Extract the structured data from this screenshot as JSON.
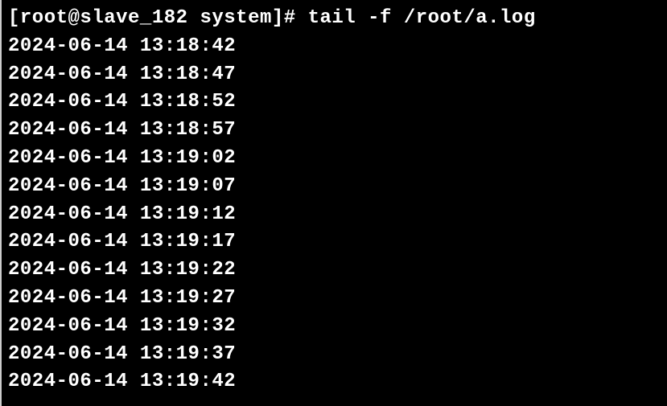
{
  "prompt": {
    "user": "root",
    "host": "slave_182",
    "cwd": "system",
    "symbol": "#",
    "command": "tail -f /root/a.log"
  },
  "log_lines": [
    "2024-06-14 13:18:42",
    "2024-06-14 13:18:47",
    "2024-06-14 13:18:52",
    "2024-06-14 13:18:57",
    "2024-06-14 13:19:02",
    "2024-06-14 13:19:07",
    "2024-06-14 13:19:12",
    "2024-06-14 13:19:17",
    "2024-06-14 13:19:22",
    "2024-06-14 13:19:27",
    "2024-06-14 13:19:32",
    "2024-06-14 13:19:37",
    "2024-06-14 13:19:42"
  ]
}
